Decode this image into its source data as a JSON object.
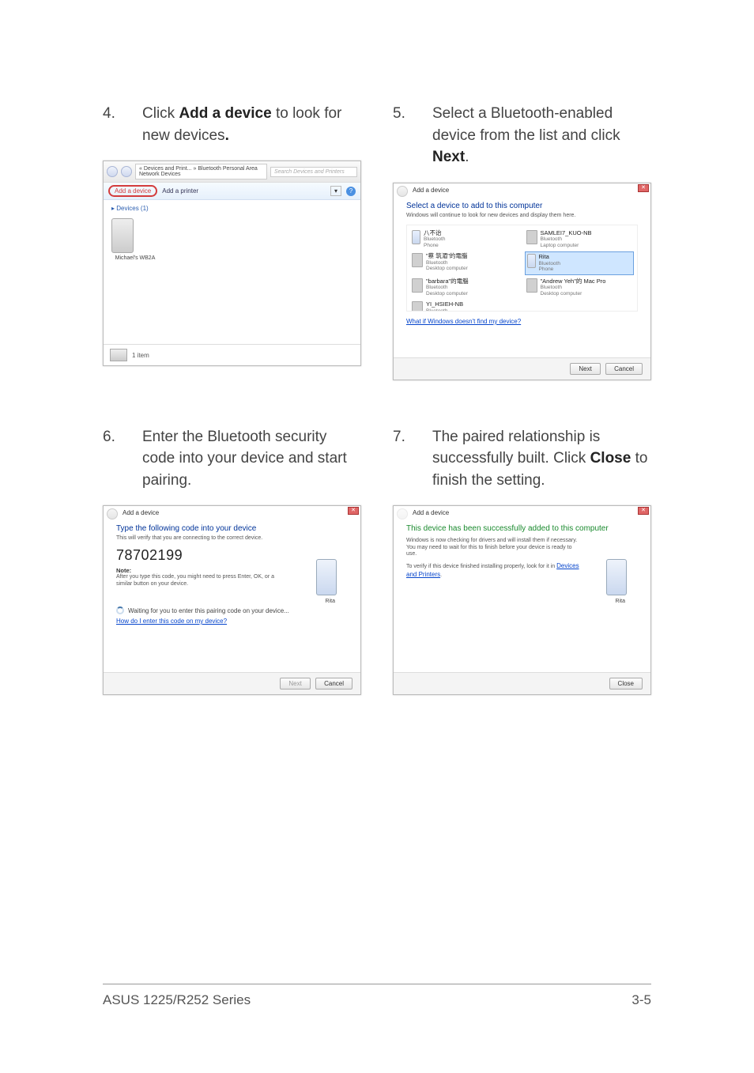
{
  "steps": {
    "s4": {
      "num": "4.",
      "pre": "Click ",
      "bold": "Add a device",
      "post": " to look for new devices"
    },
    "s5": {
      "num": "5.",
      "pre": "Select a Bluetooth-enabled device from the list and click ",
      "bold": "Next",
      "post": "."
    },
    "s6": {
      "num": "6.",
      "text": "Enter the Bluetooth security code into your device and start pairing."
    },
    "s7": {
      "num": "7.",
      "pre": "The paired relationship is successfully built. Click ",
      "bold": "Close",
      "post": " to finish the setting."
    }
  },
  "shot1": {
    "path": "« Devices and Print... » Bluetooth Personal Area Network Devices",
    "search_placeholder": "Search Devices and Printers",
    "add_device": "Add a device",
    "add_printer": "Add a printer",
    "section": "Devices (1)",
    "device_name": "Michael's WB2A",
    "status": "1 item"
  },
  "shot2": {
    "title": "Add a device",
    "hdr": "Select a device to add to this computer",
    "sub": "Windows will continue to look for new devices and display them here.",
    "devices": [
      {
        "name": "八不诒",
        "t1": "Bluetooth",
        "t2": "Phone"
      },
      {
        "name": "SAMLEI7_KUO-NB",
        "t1": "Bluetooth",
        "t2": "Laptop computer"
      },
      {
        "name": "\"蔡 筑湄\"的電腦",
        "t1": "Bluetooth",
        "t2": "Desktop computer"
      },
      {
        "name": "Rita",
        "t1": "Bluetooth",
        "t2": "Phone",
        "sel": true
      },
      {
        "name": "\"barbara\"的電腦",
        "t1": "Bluetooth",
        "t2": "Desktop computer"
      },
      {
        "name": "\"Andrew Yeh\"的 Mac Pro",
        "t1": "Bluetooth",
        "t2": "Desktop computer"
      },
      {
        "name": "YI_HSIEH-NB",
        "t1": "Bluetooth",
        "t2": ""
      }
    ],
    "help": "What if Windows doesn't find my device?",
    "next": "Next",
    "cancel": "Cancel"
  },
  "shot3": {
    "title": "Add a device",
    "hdr": "Type the following code into your device",
    "verify": "This will verify that you are connecting to the correct device.",
    "code": "78702199",
    "note_label": "Note:",
    "note": "After you type this code, you might need to press Enter, OK, or a similar button on your device.",
    "dev_caption": "Rita",
    "waiting": "Waiting for you to enter this pairing code on your device...",
    "help": "How do I enter this code on my device?",
    "next": "Next",
    "cancel": "Cancel"
  },
  "shot4": {
    "title": "Add a device",
    "hdr": "This device has been successfully added to this computer",
    "line1": "Windows is now checking for drivers and will install them if necessary. You may need to wait for this to finish before your device is ready to use.",
    "line2": "To verify if this device finished installing properly, look for it in ",
    "link": "Devices and Printers",
    "dev_caption": "Rita",
    "close": "Close"
  },
  "footer": {
    "left": "ASUS 1225/R252 Series",
    "right": "3-5"
  }
}
